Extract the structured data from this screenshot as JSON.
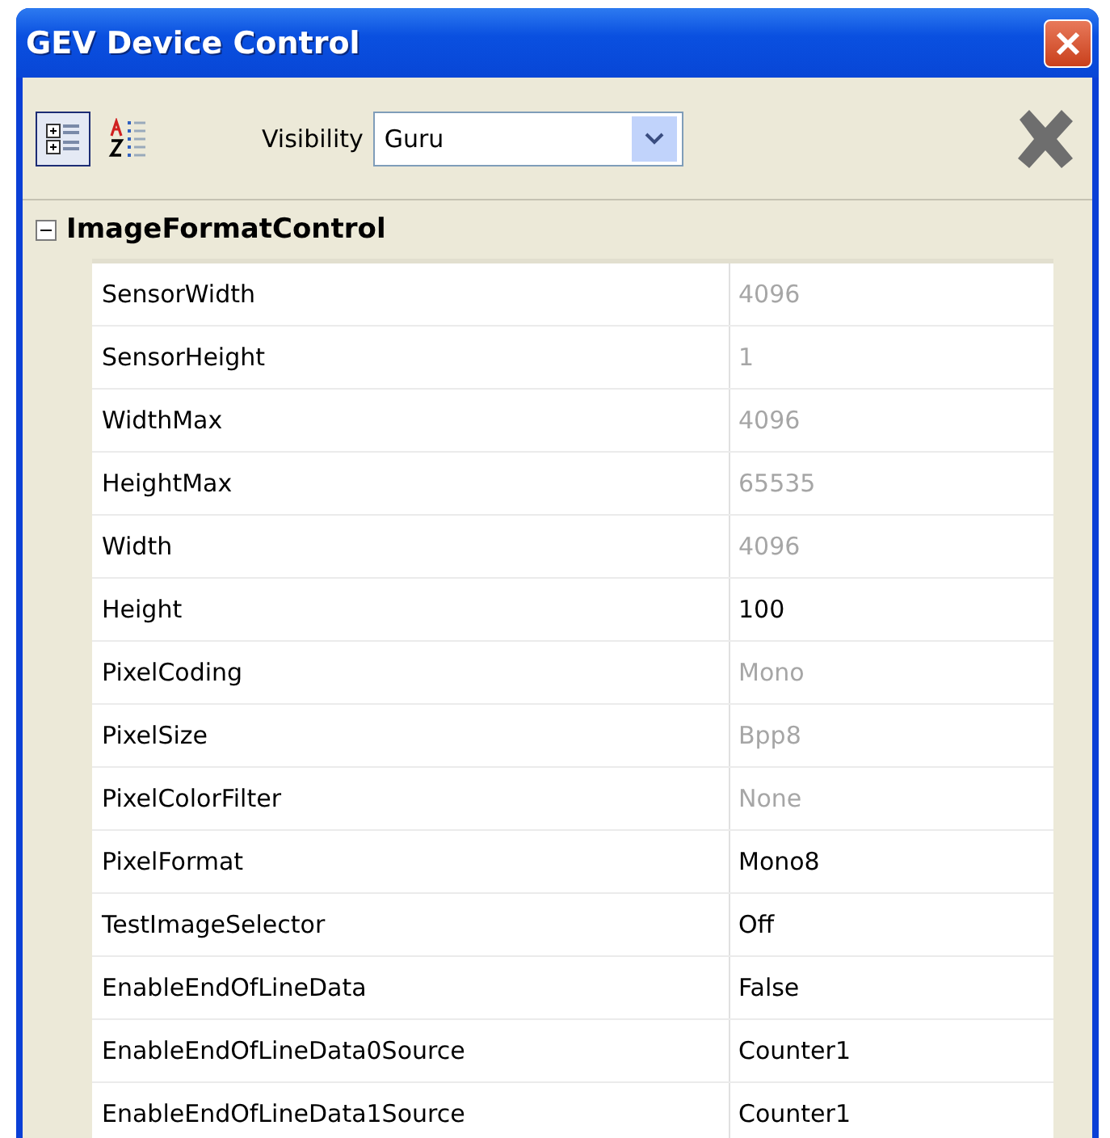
{
  "window": {
    "title": "GEV Device Control"
  },
  "toolbar": {
    "view_buttons": [
      {
        "kind": "categorized",
        "selected": true
      },
      {
        "kind": "alphabetical",
        "selected": false
      }
    ],
    "visibility_label": "Visibility",
    "visibility_value": "Guru"
  },
  "category": {
    "name": "ImageFormatControl",
    "expanded": true,
    "rows": [
      {
        "name": "SensorWidth",
        "value": "4096",
        "disabled": true
      },
      {
        "name": "SensorHeight",
        "value": "1",
        "disabled": true
      },
      {
        "name": "WidthMax",
        "value": "4096",
        "disabled": true
      },
      {
        "name": "HeightMax",
        "value": "65535",
        "disabled": true
      },
      {
        "name": "Width",
        "value": "4096",
        "disabled": true
      },
      {
        "name": "Height",
        "value": "100",
        "disabled": false
      },
      {
        "name": "PixelCoding",
        "value": "Mono",
        "disabled": true
      },
      {
        "name": "PixelSize",
        "value": "Bpp8",
        "disabled": true
      },
      {
        "name": "PixelColorFilter",
        "value": "None",
        "disabled": true
      },
      {
        "name": "PixelFormat",
        "value": "Mono8",
        "disabled": false
      },
      {
        "name": "TestImageSelector",
        "value": "Off",
        "disabled": false
      },
      {
        "name": "EnableEndOfLineData",
        "value": "False",
        "disabled": false
      },
      {
        "name": "EnableEndOfLineData0Source",
        "value": "Counter1",
        "disabled": false
      },
      {
        "name": "EnableEndOfLineData1Source",
        "value": "Counter1",
        "disabled": false
      }
    ]
  }
}
